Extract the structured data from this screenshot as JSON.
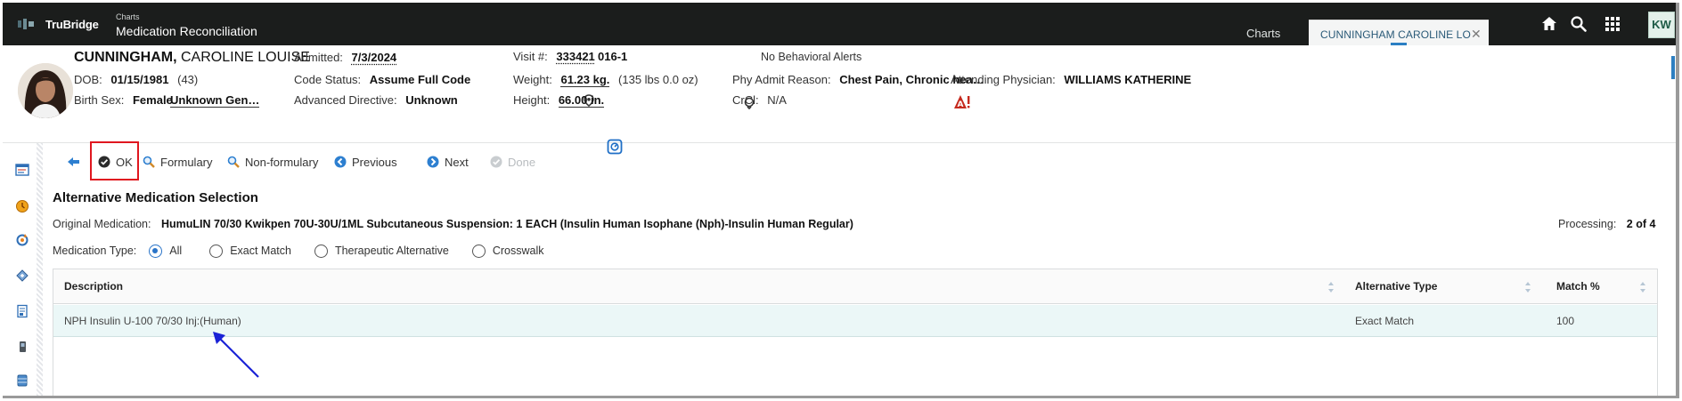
{
  "header": {
    "brand": "TruBridge",
    "breadcrumb_small": "Charts",
    "page_title": "Medication Reconciliation",
    "tabs": [
      {
        "label": "Charts"
      },
      {
        "label": "CUNNINGHAM CAROLINE LO"
      }
    ],
    "user_initials": "KW"
  },
  "patient": {
    "last_name": "CUNNINGHAM,",
    "first_names": "CAROLINE LOUISE",
    "dob_label": "DOB:",
    "dob": "01/15/1981",
    "age": "(43)",
    "birth_sex_label": "Birth Sex:",
    "birth_sex": "Female",
    "gender": "Unknown Gen…",
    "admitted_label": "Admitted:",
    "admitted": "7/3/2024",
    "code_status_label": "Code Status:",
    "code_status": "Assume Full Code",
    "adv_directive_label": "Advanced Directive:",
    "adv_directive": "Unknown",
    "visit_label": "Visit #:",
    "visit": "333421",
    "room": "016-1",
    "weight_label": "Weight:",
    "weight": "61.23 kg.",
    "weight_alt": "(135 lbs 0.0 oz)",
    "height_label": "Height:",
    "height": "66.00 in.",
    "behavioral_alerts": "No Behavioral Alerts",
    "admit_reason_label": "Phy Admit Reason:",
    "admit_reason": "Chest Pain, Chronic hea…",
    "crcl_label": "CrCl:",
    "crcl": "N/A",
    "attending_label": "Attending Physician:",
    "attending": "WILLIAMS KATHERINE"
  },
  "toolbar": {
    "ok": "OK",
    "formulary": "Formulary",
    "non_formulary": "Non-formulary",
    "previous": "Previous",
    "next": "Next",
    "done": "Done"
  },
  "content": {
    "title": "Alternative Medication Selection",
    "original_label": "Original Medication:",
    "original_value": "HumuLIN 70/30 Kwikpen 70U-30U/1ML Subcutaneous Suspension: 1 EACH (Insulin Human Isophane (Nph)-Insulin Human Regular)",
    "processing_label": "Processing:",
    "processing_value": "2 of 4",
    "medtype_label": "Medication Type:",
    "medtype_options": [
      {
        "label": "All",
        "selected": true
      },
      {
        "label": "Exact Match",
        "selected": false
      },
      {
        "label": "Therapeutic Alternative",
        "selected": false
      },
      {
        "label": "Crosswalk",
        "selected": false
      }
    ]
  },
  "table": {
    "columns": [
      "Description",
      "Alternative Type",
      "Match %"
    ],
    "rows": [
      {
        "description": "NPH Insulin U-100 70/30 Inj:(Human)",
        "type": "Exact Match",
        "match": "100"
      }
    ]
  },
  "colors": {
    "topbar": "#1b1d1c",
    "accent": "#2a74c8",
    "highlight_row": "#ebf7f7",
    "annotation_red": "#e0171f",
    "annotation_arrow": "#1a22d6"
  }
}
